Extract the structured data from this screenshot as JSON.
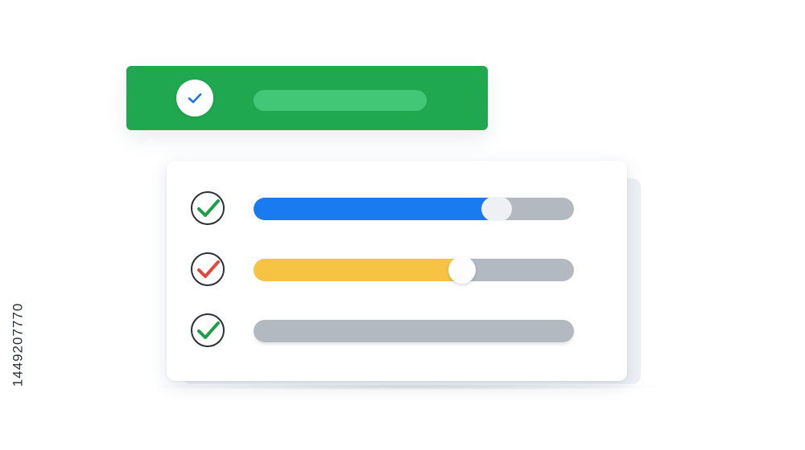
{
  "colors": {
    "banner_green": "#1fa84f",
    "banner_bar": "#41c776",
    "banner_check": "#1a73e8",
    "blue_fill": "#1a7af0",
    "yellow_fill": "#f6c343",
    "track_gray": "#b2b9c1",
    "check_green": "#1e9e4a",
    "check_red": "#e5483a",
    "circle_outline": "#2b2f36"
  },
  "banner": {
    "check_icon": "check-circle-icon"
  },
  "rows": [
    {
      "icon": "check-circle-icon",
      "check_color": "green",
      "progress_fraction": 0.76
    },
    {
      "icon": "check-circle-icon",
      "check_color": "red",
      "progress_fraction": 0.65
    },
    {
      "icon": "check-circle-icon",
      "check_color": "green",
      "progress_fraction": 0.0
    }
  ],
  "side_id": "1449207770"
}
